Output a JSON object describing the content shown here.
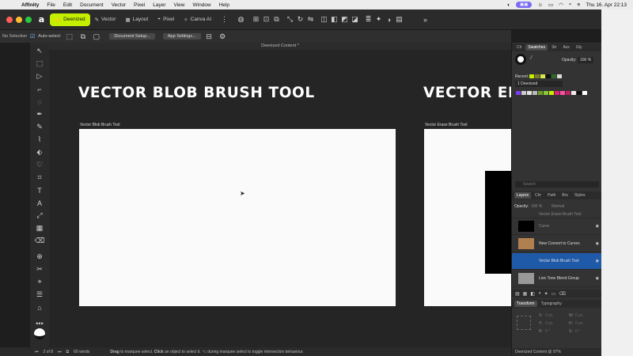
{
  "menubar": {
    "app": "Affinity",
    "items": [
      "File",
      "Edit",
      "Document",
      "Vector",
      "Pixel",
      "Layer",
      "View",
      "Window",
      "Help"
    ],
    "datetime": "Thu 16. Apr 22:13"
  },
  "toolbar": {
    "personas": [
      "Deenized",
      "Vector",
      "Layout",
      "Pixel",
      "Canva AI"
    ]
  },
  "context": {
    "selection": "No Selection",
    "auto_select": "Auto-select:",
    "doc_setup": "Document Setup...",
    "app_settings": "App Settings..."
  },
  "document": {
    "tab_title": "Deenized Content *"
  },
  "canvas": {
    "headline_1": "VECTOR BLOB BRUSH TOOL",
    "headline_2": "VECTOR ER",
    "artboard_1_label": "Vector Blob Brush Tool",
    "artboard_2_label": "Vector Erase Brush Tool"
  },
  "status": {
    "page": "2 of 8",
    "words": "60 words",
    "hint_bold_1": "Drag",
    "hint_1": "to marquee select.",
    "hint_bold_2": "Click",
    "hint_2": "an object to select it.",
    "hint_3": "during marquee select to toggle intersection behaviour."
  },
  "panels": {
    "top_tabs": [
      "Clr",
      "Swatches",
      "Str",
      "Asx",
      "Gly"
    ],
    "opacity_label": "Opacity:",
    "opacity_value": "100 %",
    "recent_label": "Recent:",
    "palette_name": "1 Deenized",
    "search_placeholder": "Search",
    "layer_tabs": [
      "Layers",
      "Chr",
      "Path",
      "Brs",
      "Styles"
    ],
    "layer_opacity_label": "Opacity:",
    "layer_opacity_value": "100 %",
    "blend_mode": "Normal",
    "layers": [
      "Vector Erase Brush Tool",
      "Curve",
      "New Convert to Curves",
      "Vector Blob Brush Tool",
      "Live Tone Blend Group"
    ],
    "transform_tabs": [
      "Transform",
      "Typography"
    ],
    "transform_labels": {
      "x": "X:",
      "y": "Y:",
      "w": "W:",
      "h": "H:",
      "r": "R:",
      "s": "S:"
    },
    "transform_values": {
      "x": "0 px",
      "y": "0 px",
      "w": "0 px",
      "h": "0 px",
      "r": "0 °",
      "s": "0 °"
    },
    "footer": "Deenized Content @ 97%"
  },
  "colors": {
    "accent": "#c4f000",
    "selection": "#1f5aa8"
  }
}
